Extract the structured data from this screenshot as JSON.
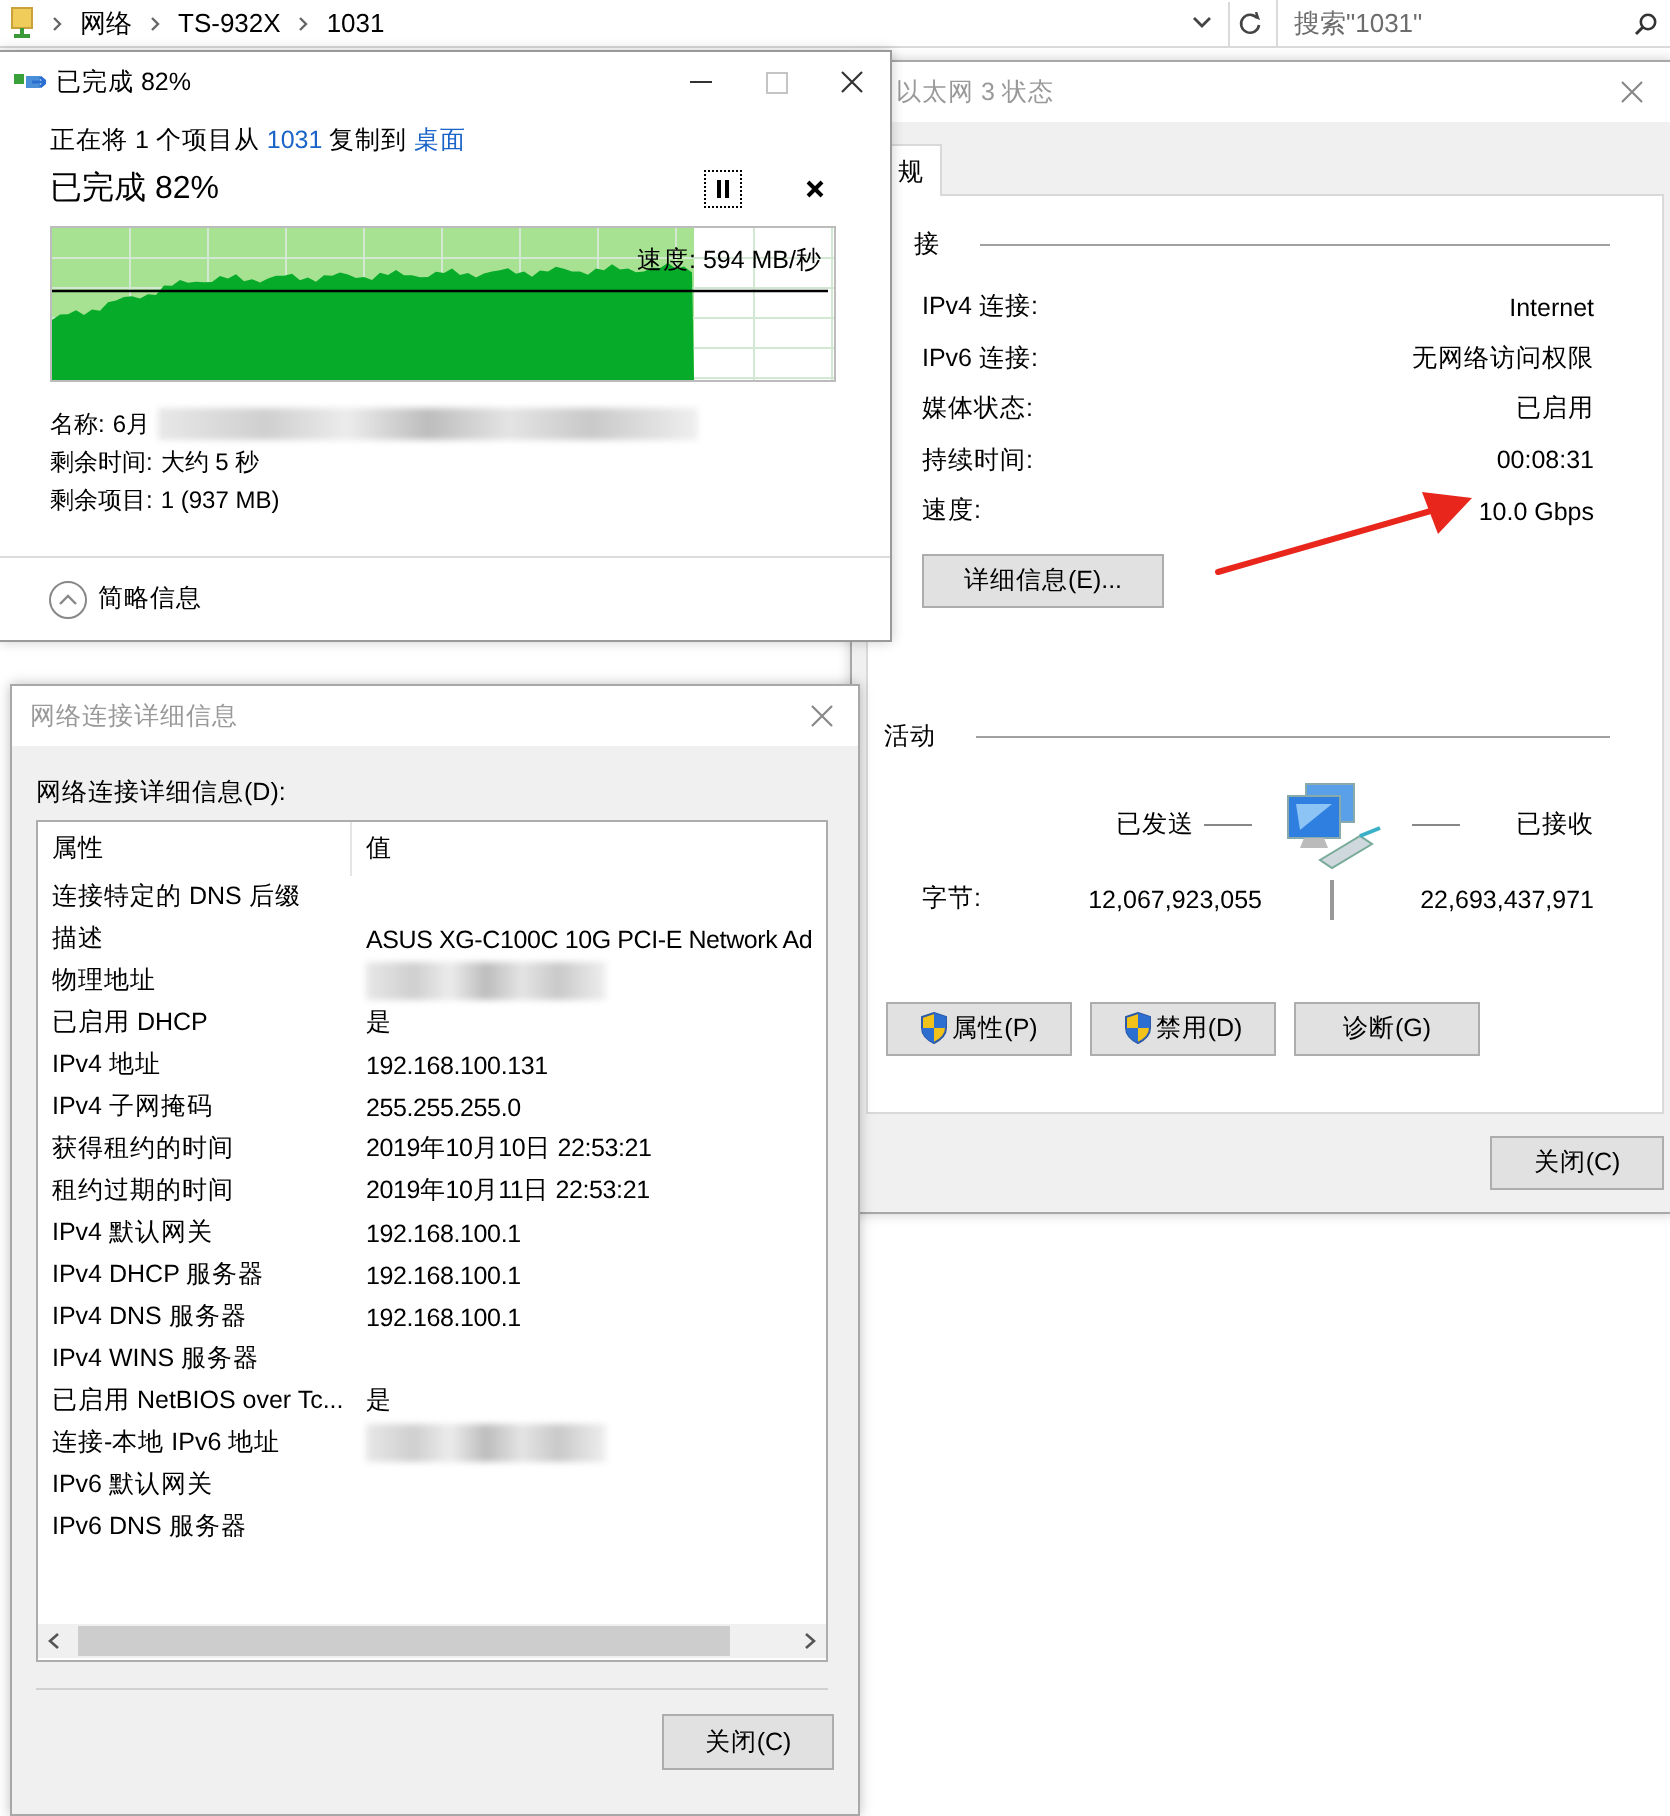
{
  "explorer": {
    "breadcrumbs": [
      "网络",
      "TS-932X",
      "1031"
    ],
    "search": {
      "placeholder": "搜索\"1031\""
    }
  },
  "copy_dialog": {
    "title": "已完成 82%",
    "active": true,
    "message": {
      "prefix": "正在将 1 个项目从",
      "source": "1031",
      "middle": "复制到",
      "destination": "桌面"
    },
    "heading": "已完成 82%",
    "progress": {
      "level": 0.82,
      "speed": "速度: 594 MB/秒"
    },
    "details": [
      {
        "label": "名称:",
        "value": "6月",
        "redacted": true
      },
      {
        "label": "剩余时间:",
        "value": "大约 5 秒",
        "redacted": false
      },
      {
        "label": "剩余项目:",
        "value": "1 (937 MB)",
        "redacted": false
      }
    ],
    "footer": {
      "label": "简略信息",
      "expanded": true
    }
  },
  "status_window": {
    "title": "以太网 3 状态",
    "active": false,
    "tabs": [
      {
        "label": "规",
        "selected": true
      }
    ],
    "connection": {
      "heading": "接",
      "rows": [
        {
          "label": "IPv4 连接:",
          "value": "Internet"
        },
        {
          "label": "IPv6 连接:",
          "value": "无网络访问权限"
        },
        {
          "label": "媒体状态:",
          "value": "已启用"
        },
        {
          "label": "持续时间:",
          "value": "00:08:31"
        },
        {
          "label": "速度:",
          "value": "10.0 Gbps"
        }
      ]
    },
    "details_button": "详细信息(E)...",
    "activity": {
      "heading": "活动",
      "sent_label": "已发送",
      "received_label": "已接收",
      "bytes_label": "字节:",
      "sent": "12,067,923,055",
      "received": "22,693,437,971"
    },
    "buttons": [
      {
        "label": "属性(P)",
        "shield": true
      },
      {
        "label": "禁用(D)",
        "shield": true
      },
      {
        "label": "诊断(G)",
        "shield": false
      }
    ],
    "close_button": "关闭(C)"
  },
  "details_dialog": {
    "title": "网络连接详细信息",
    "active": false,
    "list_label": "网络连接详细信息(D):",
    "columns": [
      "属性",
      "值"
    ],
    "rows": [
      {
        "property": "连接特定的 DNS 后缀",
        "redacted": false
      },
      {
        "property": "描述",
        "value": "ASUS XG-C100C 10G PCI-E Network Ad",
        "redacted": false
      },
      {
        "property": "物理地址",
        "redacted": true
      },
      {
        "property": "已启用 DHCP",
        "value": "是",
        "redacted": false
      },
      {
        "property": "IPv4 地址",
        "value": "192.168.100.131",
        "redacted": false
      },
      {
        "property": "IPv4 子网掩码",
        "value": "255.255.255.0",
        "redacted": false
      },
      {
        "property": "获得租约的时间",
        "value": "2019年10月10日 22:53:21",
        "redacted": false
      },
      {
        "property": "租约过期的时间",
        "value": "2019年10月11日 22:53:21",
        "redacted": false
      },
      {
        "property": "IPv4 默认网关",
        "value": "192.168.100.1",
        "redacted": false
      },
      {
        "property": "IPv4 DHCP 服务器",
        "value": "192.168.100.1",
        "redacted": false
      },
      {
        "property": "IPv4 DNS 服务器",
        "value": "192.168.100.1",
        "redacted": false
      },
      {
        "property": "IPv4 WINS 服务器",
        "redacted": false
      },
      {
        "property": "已启用 NetBIOS over Tc...",
        "value": "是",
        "redacted": false
      },
      {
        "property": "连接-本地 IPv6 地址",
        "redacted": true
      },
      {
        "property": "IPv6 默认网关",
        "redacted": false
      },
      {
        "property": "IPv6 DNS 服务器",
        "redacted": false
      }
    ],
    "close_button": "关闭(C)"
  }
}
